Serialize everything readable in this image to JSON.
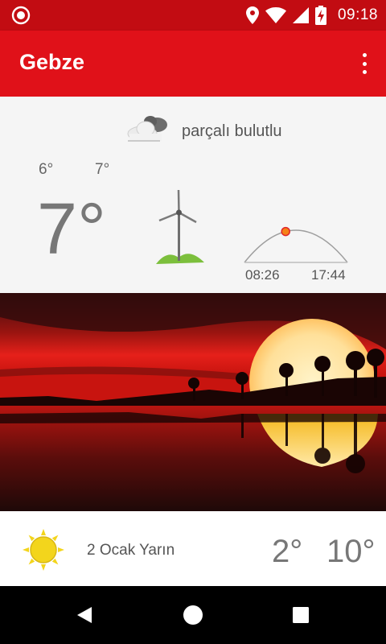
{
  "status_bar": {
    "time": "09:18",
    "icons": [
      "app-notification-icon",
      "location-icon",
      "wifi-icon",
      "cell-signal-icon",
      "battery-charging-icon"
    ]
  },
  "app_bar": {
    "title": "Gebze",
    "menu_icon": "more-vert-icon"
  },
  "current": {
    "condition": "parçalı bulutlu",
    "condition_icon": "partly-cloudy-icon",
    "low": "6°",
    "high": "7°",
    "temperature": "7°",
    "wind_icon": "wind-turbine-icon",
    "sunrise": "08:26",
    "sunset": "17:44",
    "sun_progress": 0.4
  },
  "photo": {
    "description_icon": "sunset-photo"
  },
  "forecast": {
    "icon": "sun-icon",
    "label": "2 Ocak Yarın",
    "low": "2°",
    "high": "10°"
  },
  "nav_bar": {
    "buttons": [
      "back-icon",
      "home-icon",
      "recents-icon"
    ]
  },
  "colors": {
    "status_bar": "#c20c12",
    "app_bar": "#e01119",
    "background": "#f5f5f5",
    "sun": "#f3d51c"
  }
}
